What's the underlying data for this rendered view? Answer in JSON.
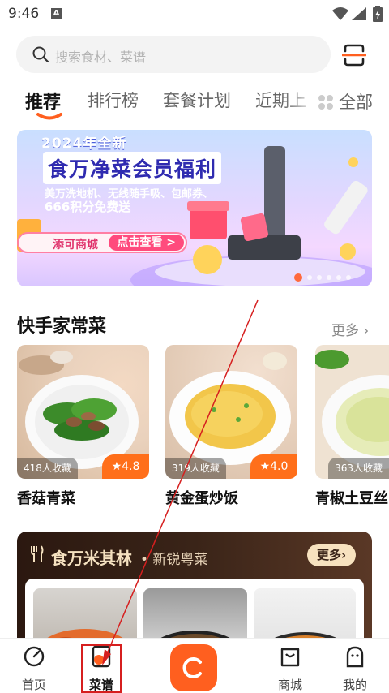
{
  "status_bar": {
    "time": "9:46",
    "a_label": "A"
  },
  "search": {
    "placeholder": "搜索食材、菜谱"
  },
  "tabs": [
    {
      "label": "推荐",
      "active": true
    },
    {
      "label": "排行榜",
      "active": false
    },
    {
      "label": "套餐计划",
      "active": false
    },
    {
      "label": "近期上",
      "active": false
    }
  ],
  "tab_all": {
    "label": "全部"
  },
  "banner": {
    "year_line": "2024年全新",
    "headline": "食万净菜会员福利",
    "sub1": "美万洗地机、无线随手吸、包邮券、",
    "sub2": "666积分免费送",
    "mall_label": "添可商城",
    "cta_label": "点击查看 >"
  },
  "section": {
    "title": "快手家常菜",
    "more_label": "更多",
    "cards": [
      {
        "name": "香菇青菜",
        "favorites": "418人收藏",
        "rating": "4.8"
      },
      {
        "name": "黄金蛋炒饭",
        "favorites": "319人收藏",
        "rating": "4.0"
      },
      {
        "name": "青椒土豆丝",
        "favorites": "363人收藏",
        "rating": ""
      }
    ]
  },
  "michelin": {
    "title": "食万米其林",
    "subtitle": "• 新锐粤菜",
    "more_label": "更多"
  },
  "bottom_nav": [
    {
      "label": "首页",
      "icon": "home-icon",
      "active": false
    },
    {
      "label": "菜谱",
      "icon": "recipe-book-icon",
      "active": true
    },
    {
      "label": "",
      "icon": "cook-center-icon",
      "active": false
    },
    {
      "label": "商城",
      "icon": "shopping-bag-icon",
      "active": false
    },
    {
      "label": "我的",
      "icon": "profile-icon",
      "active": false
    }
  ],
  "colors": {
    "accent": "#ff5f1f",
    "rating_badge": "#ff6f1a",
    "annotation": "#d61f1f"
  }
}
